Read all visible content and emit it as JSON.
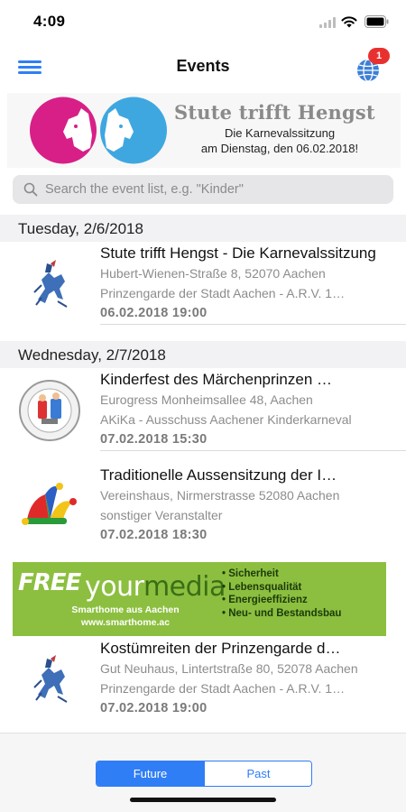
{
  "status_bar": {
    "time": "4:09"
  },
  "navbar": {
    "title": "Events",
    "notification_count": "1"
  },
  "banner_top": {
    "title": "Stute trifft Hengst",
    "line1": "Die Karnevalssitzung",
    "line2": "am Dienstag, den 06.02.2018!",
    "colors": {
      "left_circle": "#d81f87",
      "right_circle": "#3fa7e0"
    }
  },
  "search": {
    "placeholder": "Search the event list, e.g. \"Kinder\"",
    "value": ""
  },
  "sections": [
    {
      "header": "Tuesday, 2/6/2018",
      "events": [
        {
          "icon": "rider-icon",
          "title": "Stute trifft Hengst - Die Karnevalssitzung",
          "address": "Hubert-Wienen-Straße 8, 52070 Aachen",
          "organizer": "Prinzengarde der Stadt Aachen - A.R.V. 1…",
          "datetime": "06.02.2018 19:00"
        }
      ]
    },
    {
      "header": "Wednesday, 2/7/2018",
      "events": [
        {
          "icon": "akika-seal-icon",
          "title": "Kinderfest des Märchenprinzen …",
          "address": "Eurogress Monheimsallee 48, Aachen",
          "organizer": "AKiKa - Ausschuss Aachener Kinderkarneval",
          "datetime": "07.02.2018 15:30"
        },
        {
          "icon": "jester-hat-icon",
          "title": "Traditionelle Aussensitzung der I…",
          "address": "Vereinshaus, Nirmerstrasse 52080 Aachen",
          "organizer": "sonstiger Veranstalter",
          "datetime": "07.02.2018 18:30"
        }
      ]
    }
  ],
  "ad_banner": {
    "free": "FREE",
    "brand_a": "your",
    "brand_b": "media",
    "line1": "Smarthome aus Aachen",
    "line2": "www.smarthome.ac",
    "bullets": [
      "• Sicherheit",
      "• Lebensqualität",
      "• Energieeffizienz",
      "• Neu- und Bestandsbau"
    ]
  },
  "event_after_ad": {
    "icon": "rider-icon",
    "title": "Kostümreiten der Prinzengarde d…",
    "address": "Gut Neuhaus, Lintertstraße 80, 52078 Aachen",
    "organizer": "Prinzengarde der Stadt Aachen - A.R.V. 1…",
    "datetime": "07.02.2018 19:00"
  },
  "segmented": {
    "future": "Future",
    "past": "Past",
    "selected": "Future"
  },
  "colors": {
    "accent": "#2f7ef6",
    "badge": "#e8312f",
    "ad_green": "#8cbf3f"
  }
}
